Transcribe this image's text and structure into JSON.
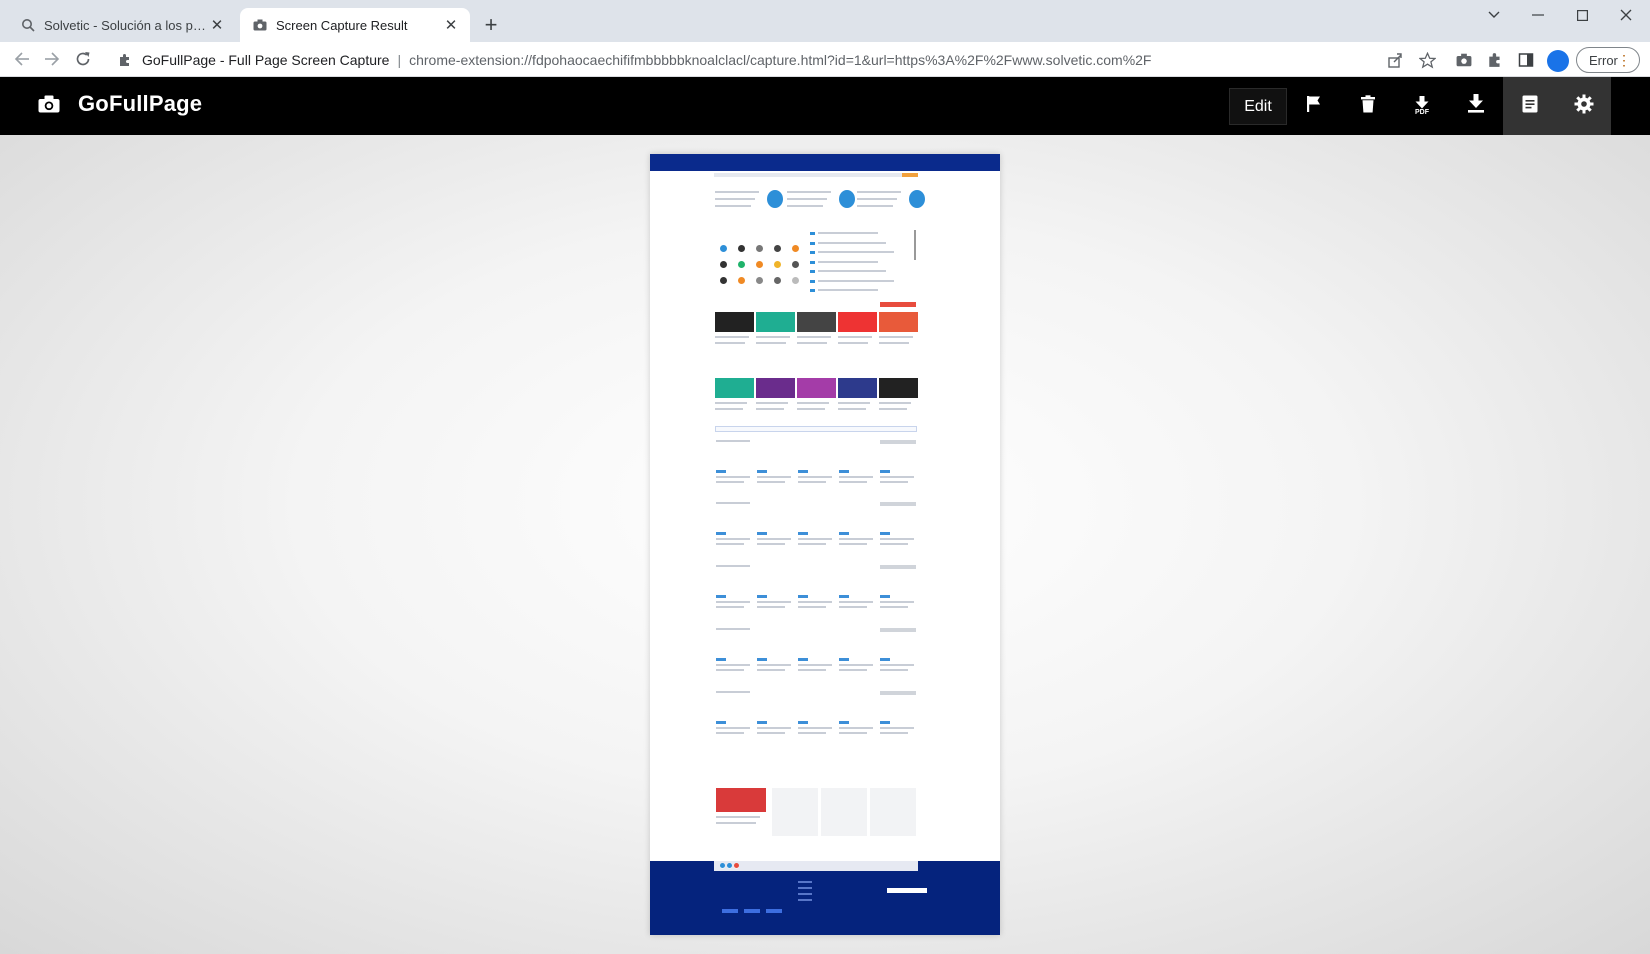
{
  "tabs": [
    {
      "title": "Solvetic - Solución a los problemas",
      "active": false
    },
    {
      "title": "Screen Capture Result",
      "active": true
    }
  ],
  "toolbar": {
    "ext_label": "GoFullPage - Full Page Screen Capture",
    "url": "chrome-extension://fdpohaocaechififmbbbbbknoalclacl/capture.html?id=1&url=https%3A%2F%2Fwww.solvetic.com%2F",
    "profile_label": "",
    "error_label": "Error"
  },
  "app": {
    "title": "GoFullPage",
    "edit_label": "Edit",
    "pdf_label": "PDF"
  },
  "icons": {
    "camera": "camera-icon",
    "flag": "flag-icon",
    "trash": "trash-icon",
    "download_pdf": "download-pdf-icon",
    "download": "download-icon",
    "list": "file-list-icon",
    "settings": "gear-icon"
  },
  "colors": {
    "header_bg": "#000000",
    "preview_brand": "#0a2a8c",
    "tab_strip": "#dee3ea"
  }
}
